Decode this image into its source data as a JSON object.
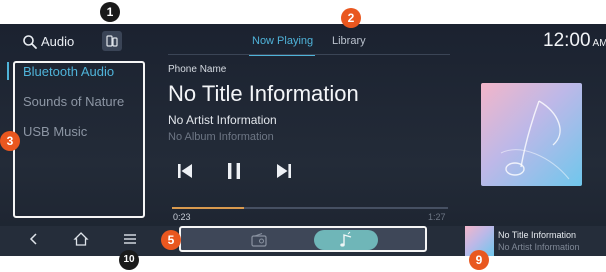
{
  "header": {
    "title": "Audio",
    "tabs": [
      {
        "label": "Now Playing",
        "active": true
      },
      {
        "label": "Library",
        "active": false
      }
    ],
    "clock": "12:00",
    "ampm": "AM"
  },
  "sidebar": {
    "items": [
      {
        "label": "Bluetooth Audio",
        "active": true
      },
      {
        "label": "Sounds of Nature",
        "active": false
      },
      {
        "label": "USB Music",
        "active": false
      }
    ]
  },
  "now_playing": {
    "device_name": "Phone Name",
    "title": "No Title Information",
    "artist": "No Artist Information",
    "album": "No Album Information",
    "elapsed": "0:23",
    "total": "1:27",
    "progress": 0.26
  },
  "mini_player": {
    "title": "No Title Information",
    "artist": "No Artist Information"
  },
  "callouts": [
    "1",
    "2",
    "3",
    "5",
    "9",
    "10"
  ],
  "colors": {
    "accent": "#4fb3d9",
    "callout": "#e9571f",
    "callout_dark": "#1a1a1a",
    "progress_fill": "#d99a4e",
    "media_pill": "#6fb6b8",
    "background": "#1b2230"
  },
  "icons": {
    "search": "search-icon",
    "source_switch": "source-switch-icon",
    "prev": "skip-previous-icon",
    "pause": "pause-icon",
    "next": "skip-next-icon",
    "back": "back-icon",
    "home": "home-icon",
    "menu": "menu-icon",
    "radio": "radio-icon",
    "media": "music-note-icon"
  }
}
